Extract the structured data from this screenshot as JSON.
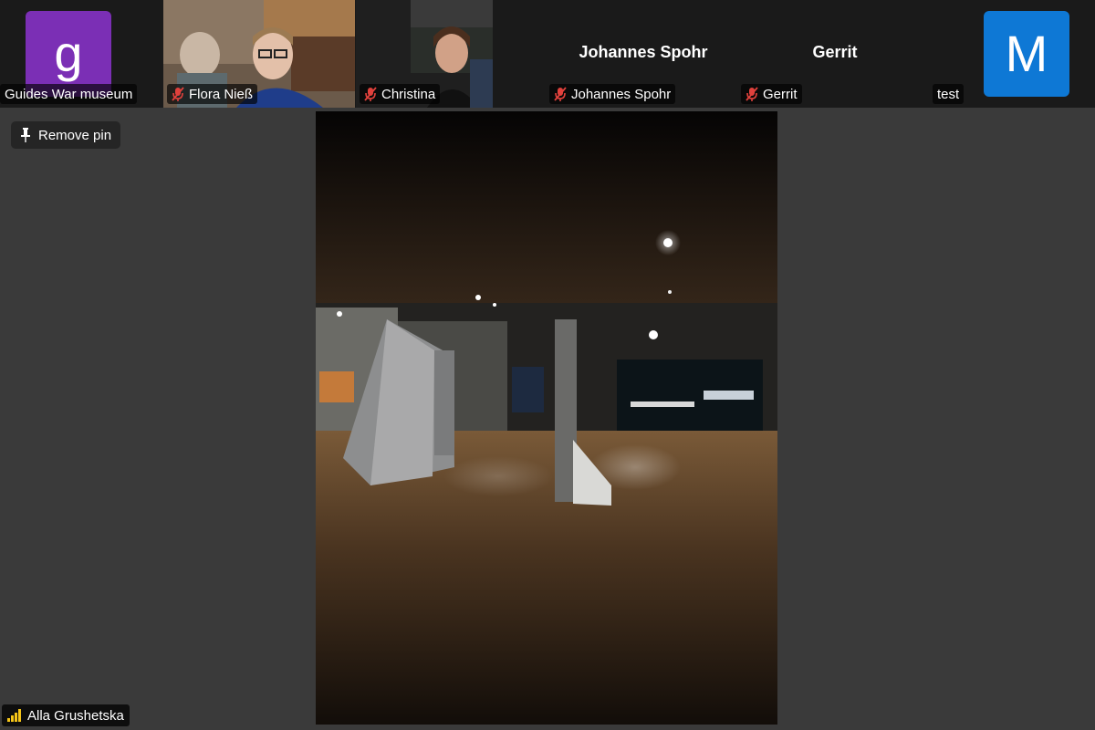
{
  "participants": [
    {
      "name": "Guides War museum",
      "avatar_letter": "g",
      "avatar_color": "#7b2fb5",
      "muted": false
    },
    {
      "name": "Flora Nieß",
      "muted": true
    },
    {
      "name": "Christina",
      "muted": true
    },
    {
      "name": "Johannes Spohr",
      "display_name": "Johannes Spohr",
      "muted": true
    },
    {
      "name": "Gerrit",
      "display_name": "Gerrit",
      "muted": true
    },
    {
      "name": "test",
      "avatar_letter": "M",
      "avatar_color": "#0e78d5",
      "muted": false
    }
  ],
  "pin": {
    "label": "Remove pin"
  },
  "main_speaker": {
    "name": "Alla Grushetska"
  },
  "colors": {
    "mute_icon": "#e0413c",
    "signal_icon": "#f5c518"
  }
}
